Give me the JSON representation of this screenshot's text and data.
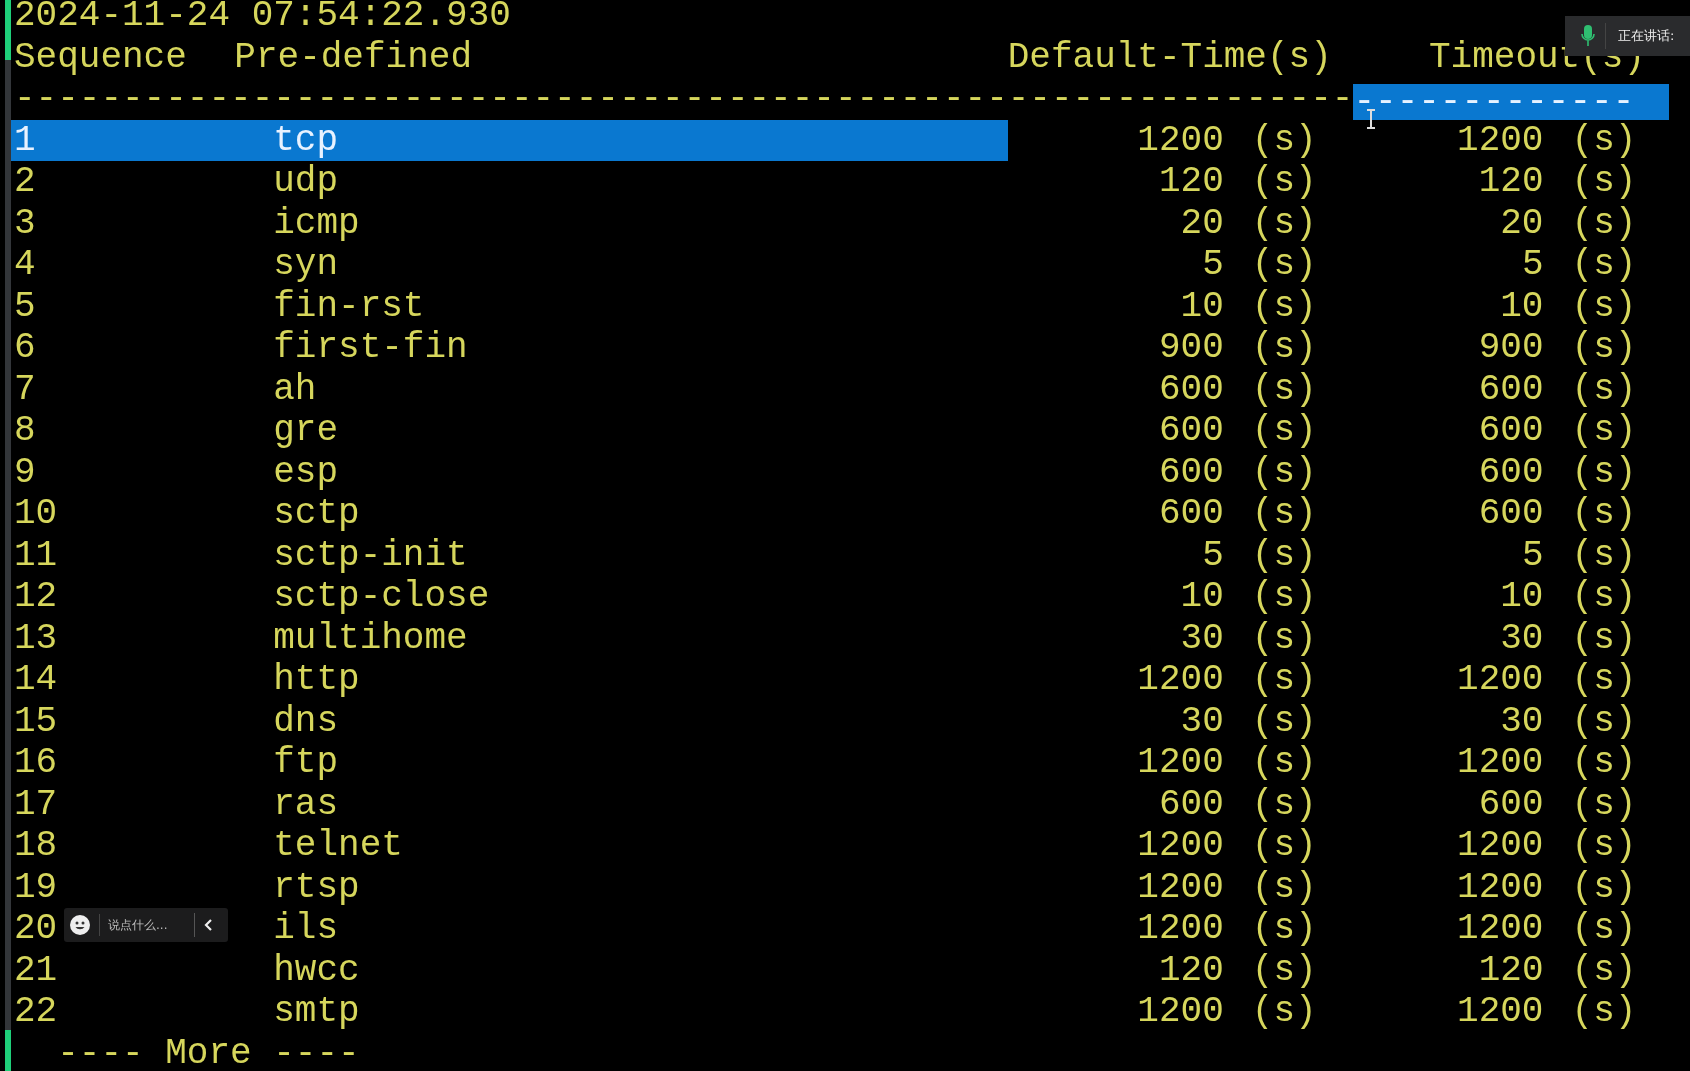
{
  "timestamp": "2024-11-24 07:54:22.930",
  "header": {
    "columns": [
      "Sequence",
      "Pre-defined",
      "Default-Time(s)",
      "Timeout(s)"
    ]
  },
  "separator": [
    {
      "text": "--------------------------------------------------------------",
      "selected": false
    },
    {
      "text": "-------------",
      "selected": true
    }
  ],
  "rows": [
    {
      "sequence": "1",
      "name": "tcp",
      "default": "1200",
      "default_unit": "(s)",
      "timeout": "1200",
      "timeout_unit": "(s)",
      "selected": true
    },
    {
      "sequence": "2",
      "name": "udp",
      "default": "120",
      "default_unit": "(s)",
      "timeout": "120",
      "timeout_unit": "(s)",
      "selected": false
    },
    {
      "sequence": "3",
      "name": "icmp",
      "default": "20",
      "default_unit": "(s)",
      "timeout": "20",
      "timeout_unit": "(s)",
      "selected": false
    },
    {
      "sequence": "4",
      "name": "syn",
      "default": "5",
      "default_unit": "(s)",
      "timeout": "5",
      "timeout_unit": "(s)",
      "selected": false
    },
    {
      "sequence": "5",
      "name": "fin-rst",
      "default": "10",
      "default_unit": "(s)",
      "timeout": "10",
      "timeout_unit": "(s)",
      "selected": false
    },
    {
      "sequence": "6",
      "name": "first-fin",
      "default": "900",
      "default_unit": "(s)",
      "timeout": "900",
      "timeout_unit": "(s)",
      "selected": false
    },
    {
      "sequence": "7",
      "name": "ah",
      "default": "600",
      "default_unit": "(s)",
      "timeout": "600",
      "timeout_unit": "(s)",
      "selected": false
    },
    {
      "sequence": "8",
      "name": "gre",
      "default": "600",
      "default_unit": "(s)",
      "timeout": "600",
      "timeout_unit": "(s)",
      "selected": false
    },
    {
      "sequence": "9",
      "name": "esp",
      "default": "600",
      "default_unit": "(s)",
      "timeout": "600",
      "timeout_unit": "(s)",
      "selected": false
    },
    {
      "sequence": "10",
      "name": "sctp",
      "default": "600",
      "default_unit": "(s)",
      "timeout": "600",
      "timeout_unit": "(s)",
      "selected": false
    },
    {
      "sequence": "11",
      "name": "sctp-init",
      "default": "5",
      "default_unit": "(s)",
      "timeout": "5",
      "timeout_unit": "(s)",
      "selected": false
    },
    {
      "sequence": "12",
      "name": "sctp-close",
      "default": "10",
      "default_unit": "(s)",
      "timeout": "10",
      "timeout_unit": "(s)",
      "selected": false
    },
    {
      "sequence": "13",
      "name": "multihome",
      "default": "30",
      "default_unit": "(s)",
      "timeout": "30",
      "timeout_unit": "(s)",
      "selected": false
    },
    {
      "sequence": "14",
      "name": "http",
      "default": "1200",
      "default_unit": "(s)",
      "timeout": "1200",
      "timeout_unit": "(s)",
      "selected": false
    },
    {
      "sequence": "15",
      "name": "dns",
      "default": "30",
      "default_unit": "(s)",
      "timeout": "30",
      "timeout_unit": "(s)",
      "selected": false
    },
    {
      "sequence": "16",
      "name": "ftp",
      "default": "1200",
      "default_unit": "(s)",
      "timeout": "1200",
      "timeout_unit": "(s)",
      "selected": false
    },
    {
      "sequence": "17",
      "name": "ras",
      "default": "600",
      "default_unit": "(s)",
      "timeout": "600",
      "timeout_unit": "(s)",
      "selected": false
    },
    {
      "sequence": "18",
      "name": "telnet",
      "default": "1200",
      "default_unit": "(s)",
      "timeout": "1200",
      "timeout_unit": "(s)",
      "selected": false
    },
    {
      "sequence": "19",
      "name": "rtsp",
      "default": "1200",
      "default_unit": "(s)",
      "timeout": "1200",
      "timeout_unit": "(s)",
      "selected": false
    },
    {
      "sequence": "20",
      "name": "ils",
      "default": "1200",
      "default_unit": "(s)",
      "timeout": "1200",
      "timeout_unit": "(s)",
      "selected": false
    },
    {
      "sequence": "21",
      "name": "hwcc",
      "default": "120",
      "default_unit": "(s)",
      "timeout": "120",
      "timeout_unit": "(s)",
      "selected": false
    },
    {
      "sequence": "22",
      "name": "smtp",
      "default": "1200",
      "default_unit": "(s)",
      "timeout": "1200",
      "timeout_unit": "(s)",
      "selected": false
    }
  ],
  "more_prompt": "---- More ----",
  "speaking_indicator": {
    "label": "正在讲话:"
  },
  "chat_bar": {
    "placeholder": "说点什么..."
  }
}
